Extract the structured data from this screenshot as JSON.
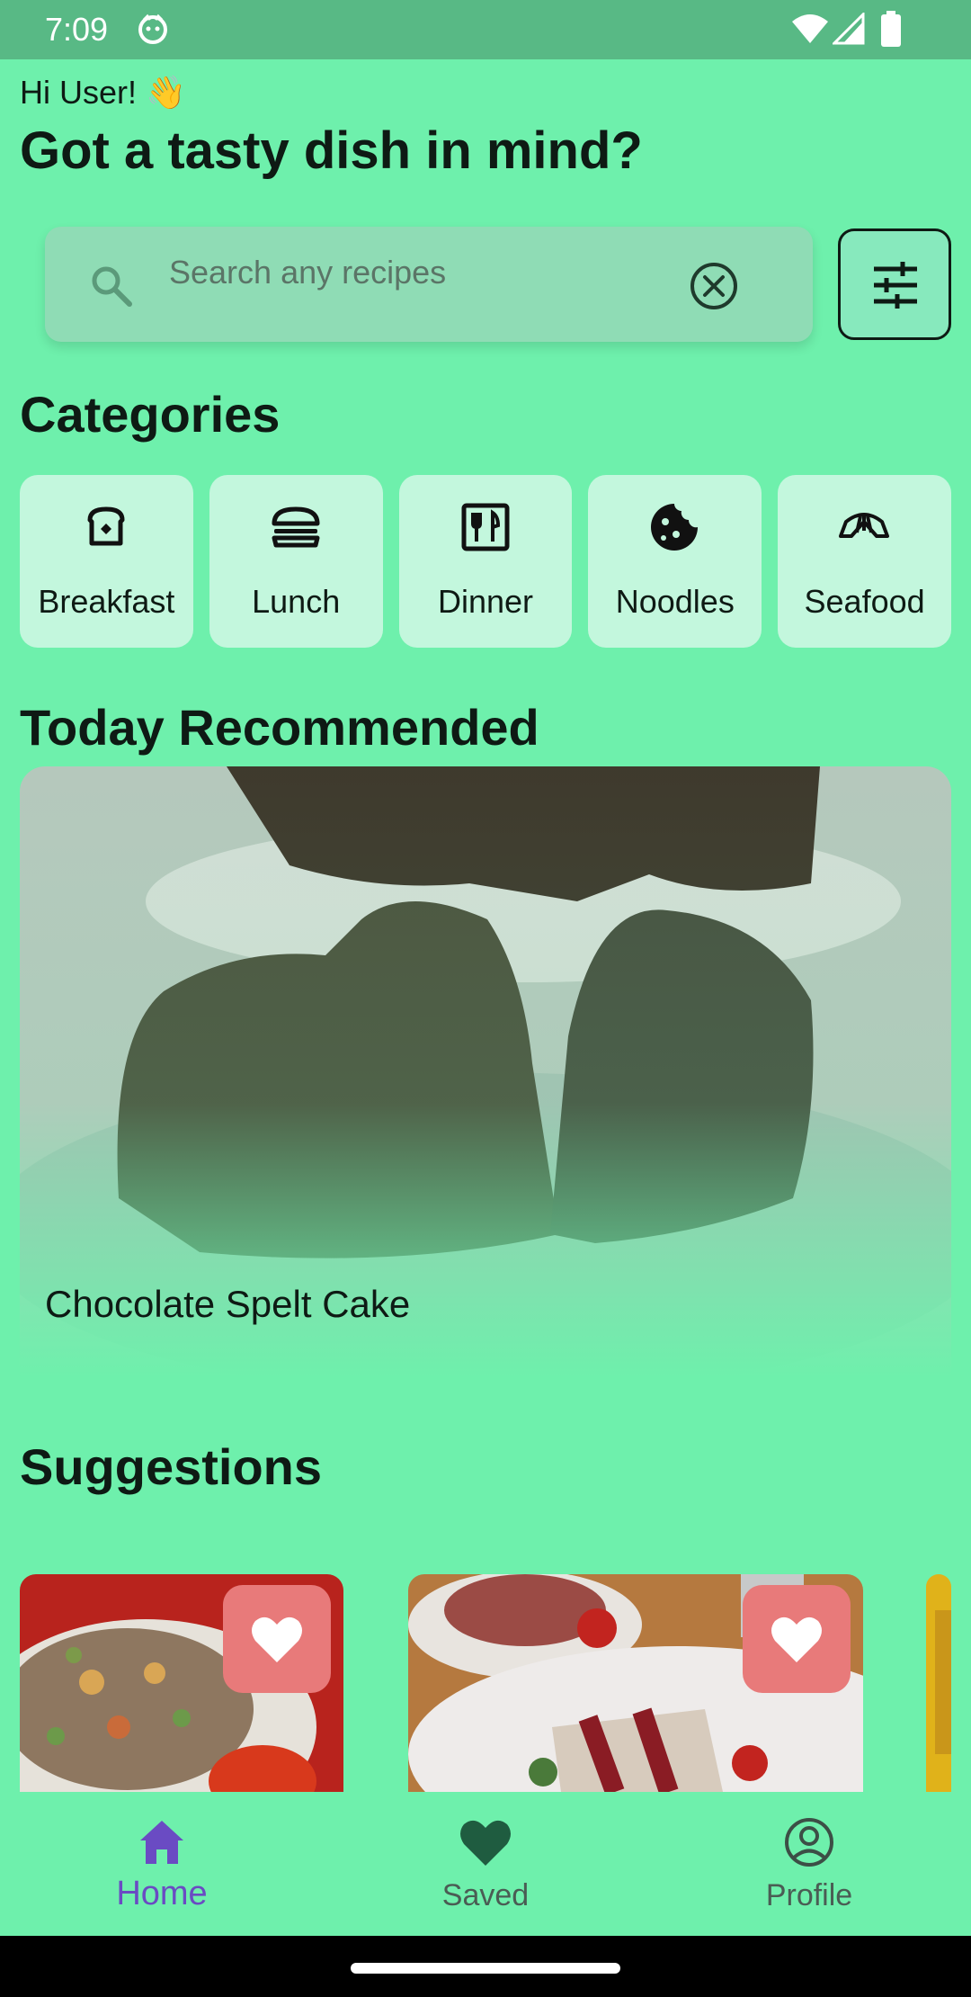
{
  "status_bar": {
    "time": "7:09"
  },
  "header": {
    "greeting": "Hi User! 👋",
    "title": "Got a tasty dish in mind?"
  },
  "search": {
    "placeholder": "Search any recipes",
    "search_icon": "search-icon",
    "clear_icon": "clear-icon",
    "filter_icon": "tune-icon"
  },
  "categories": {
    "title": "Categories",
    "items": [
      {
        "label": "Breakfast",
        "icon": "toast-icon"
      },
      {
        "label": "Lunch",
        "icon": "burger-icon"
      },
      {
        "label": "Dinner",
        "icon": "dinner-icon"
      },
      {
        "label": "Noodles",
        "icon": "cookie-icon"
      },
      {
        "label": "Seafood",
        "icon": "seafood-icon"
      }
    ]
  },
  "recommended": {
    "title": "Today Recommended",
    "recipe_name": "Chocolate Spelt Cake"
  },
  "suggestions": {
    "title": "Suggestions"
  },
  "bottom_nav": {
    "items": [
      {
        "label": "Home",
        "icon": "home-icon",
        "active": true
      },
      {
        "label": "Saved",
        "icon": "heart-icon",
        "active": false
      },
      {
        "label": "Profile",
        "icon": "account-circle-icon",
        "active": false
      }
    ]
  },
  "colors": {
    "background": "#6ef0ac",
    "status_bar": "#58b985",
    "card": "#c3f7dd",
    "favorite": "#e87a7a",
    "nav_active": "#6a4bc3"
  }
}
